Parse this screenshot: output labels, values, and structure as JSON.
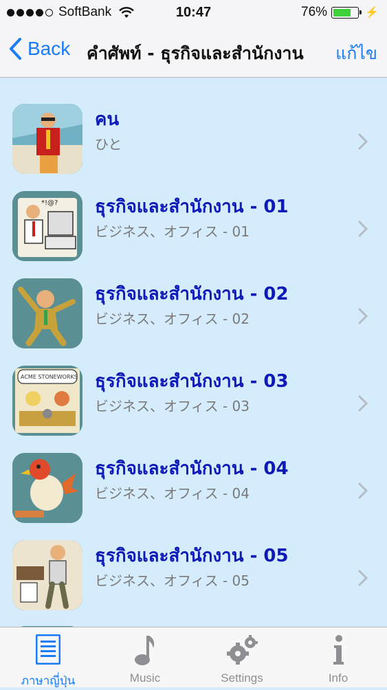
{
  "status": {
    "carrier": "SoftBank",
    "time": "10:47",
    "battery_text": "76%",
    "battery_level": 0.76
  },
  "nav": {
    "back_label": "Back",
    "title": "คำศัพท์ - ธุรกิจและสำนักงาน",
    "edit_label": "แก้ไข"
  },
  "items": [
    {
      "title": "คน",
      "subtitle": "ひと"
    },
    {
      "title": "ธุรกิจและสำนักงาน - 01",
      "subtitle": "ビジネス、オフィス - 01"
    },
    {
      "title": "ธุรกิจและสำนักงาน - 02",
      "subtitle": "ビジネス、オフィス - 02"
    },
    {
      "title": "ธุรกิจและสำนักงาน - 03",
      "subtitle": "ビジネス、オフィス - 03"
    },
    {
      "title": "ธุรกิจและสำนักงาน - 04",
      "subtitle": "ビジネス、オフィス - 04"
    },
    {
      "title": "ธุรกิจและสำนักงาน - 05",
      "subtitle": "ビジネス、オフィス - 05"
    }
  ],
  "tabs": [
    {
      "label": "ภาษาญี่ปุ่น",
      "icon": "list-document-icon",
      "active": true
    },
    {
      "label": "Music",
      "icon": "music-note-icon",
      "active": false
    },
    {
      "label": "Settings",
      "icon": "gears-icon",
      "active": false
    },
    {
      "label": "Info",
      "icon": "info-icon",
      "active": false
    }
  ],
  "colors": {
    "accent": "#1a7cf5",
    "title_text": "#0d1ab8",
    "list_background": "#d4ecfb",
    "battery_fill": "#3fd13a"
  }
}
